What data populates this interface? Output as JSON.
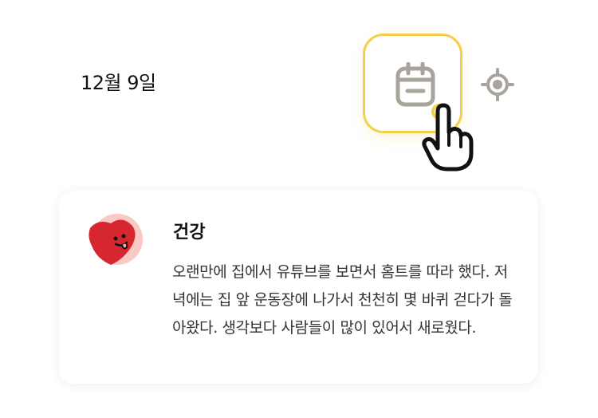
{
  "header": {
    "date": "12월 9일"
  },
  "toolbar": {
    "calendar_icon": "calendar-icon",
    "locate_icon": "location-target-icon",
    "cursor_icon": "pointer-hand-icon"
  },
  "entry": {
    "category_icon": "heart-face-icon",
    "category": "건강",
    "text": "오랜만에 집에서 유튜브를 보면서 홈트를 따라 했다. 저녁에는 집 앞 운동장에 나가서 천천히 몇 바퀴 걷다가 돌아왔다. 생각보다 사람들이 많이 있어서 새로웠다."
  },
  "colors": {
    "accent": "#f6ce4a",
    "icon_gray": "#a8a39b",
    "heart_red": "#d6262f",
    "heart_bg": "#f9c9c4"
  }
}
